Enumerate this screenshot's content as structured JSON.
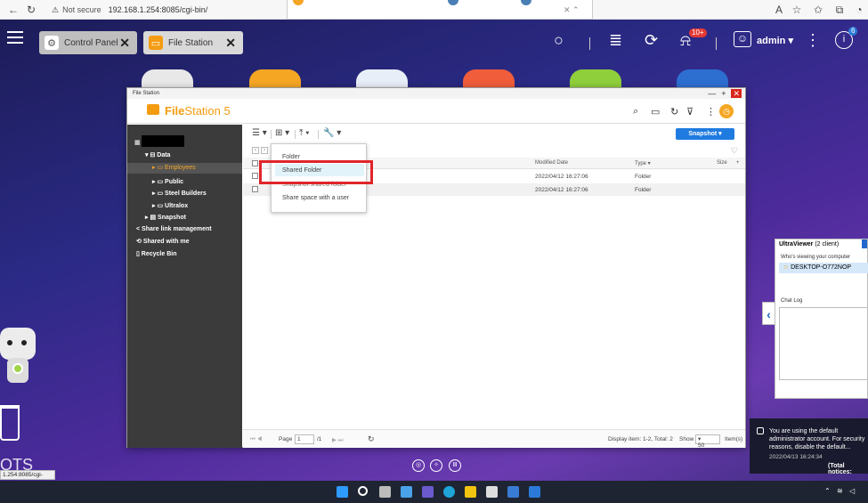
{
  "browser": {
    "not_secure": "Not secure",
    "url": "192.168.1.254:8085/cgi-bin/"
  },
  "desktop_header": {
    "tabs": [
      {
        "label": "Control Panel"
      },
      {
        "label": "File Station"
      }
    ],
    "notification_badge": "10+",
    "user": "admin ▾",
    "info_badge": "6"
  },
  "file_station": {
    "window_title": "File Station",
    "logo_bold": "File",
    "logo_rest": "Station 5",
    "sidebar": {
      "items": [
        {
          "label": "Data"
        },
        {
          "label": "Employees"
        },
        {
          "label": "Public"
        },
        {
          "label": "Steel Builders"
        },
        {
          "label": "Ultralox"
        },
        {
          "label": "Snapshot"
        },
        {
          "label": "Share link management"
        },
        {
          "label": "Shared with me"
        },
        {
          "label": "Recycle Bin"
        }
      ]
    },
    "toolbar": {
      "snapshot_label": "Snapshot ▾"
    },
    "list": {
      "columns": {
        "modified": "Modified Date",
        "type": "Type ▾",
        "size": "Size"
      },
      "rows": [
        {
          "modified": "2022/04/12 16:27:06",
          "type": "Folder"
        },
        {
          "modified": "2022/04/12 16:27:06",
          "type": "Folder"
        }
      ]
    },
    "dropdown": {
      "items": [
        "Folder",
        "Shared Folder",
        "Snapshot shared folder",
        "Share space with a user"
      ]
    },
    "pager": {
      "page_label": "Page",
      "page_value": "1",
      "page_total": "/1",
      "display_info": "Display item: 1-2, Total: 2",
      "show_label": "Show",
      "show_value": "50",
      "items_label": "Item(s)"
    }
  },
  "ultraviewer": {
    "title": "UltraViewer",
    "client_count": "(2 client)",
    "viewing_label": "Who's viewing your computer",
    "device": "DESKTOP-O772NOP",
    "chat_label": "Chat Log"
  },
  "notice": {
    "text": "You are using the default administrator account. For security reasons, disable the default...",
    "time": "2022/04/13 16:24:34",
    "total": "(Total notices:"
  },
  "status_url": "1.254:8085/cgi-bin/#",
  "desktop_logo": "QTS"
}
